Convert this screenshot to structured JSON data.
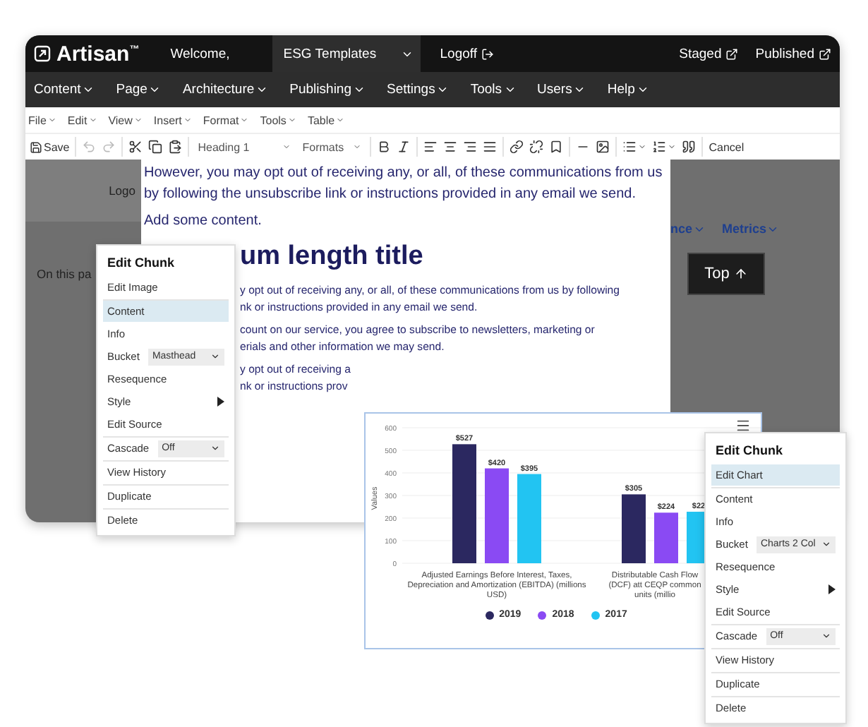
{
  "app_bar": {
    "brand": "Artisan$^{™}$",
    "welcome": "Welcome,",
    "site_select": "ESG Templates",
    "logoff": "Logoff",
    "links": [
      "Staged",
      "Published"
    ]
  },
  "nav": [
    "Content",
    "Page",
    "Architecture",
    "Publishing",
    "Settings",
    "Tools",
    "Users",
    "Help"
  ],
  "editor_menu": [
    "File",
    "Edit",
    "View",
    "Insert",
    "Format",
    "Tools",
    "Table"
  ],
  "toolbar": {
    "save": "Save",
    "undo_disabled": true,
    "redo_disabled": true,
    "block_format": "Heading 1",
    "formats": "Formats",
    "cancel": "Cancel"
  },
  "sidebar": {
    "logo": "Logo",
    "on_this_page": "On this pa"
  },
  "page": {
    "blocks": [
      {
        "kind": "paragraph",
        "text": "However, you may opt out of receiving any, or all, of these communications from us by following the unsubscribe link or instructions provided in any email we send."
      },
      {
        "kind": "paragraph",
        "text": "Add some content."
      },
      {
        "kind": "heading",
        "text": "um length title"
      },
      {
        "kind": "clipped",
        "lines": [
          "y opt out of receiving any, or all, of these communications from us by following",
          "nk or instructions provided in any email we send."
        ]
      },
      {
        "kind": "clipped",
        "lines": [
          "count on our service, you agree to subscribe to newsletters, marketing or",
          "erials and other information we may send."
        ]
      },
      {
        "kind": "clipped",
        "lines": [
          "y opt out of receiving a",
          "nk or instructions prov"
        ]
      }
    ]
  },
  "page_links": [
    "nce",
    "Metrics"
  ],
  "top_button": "Top",
  "chart": {
    "chart_data": {
      "type": "bar",
      "ylabel": "Values",
      "categories": [
        "Adjusted Earnings Before Interest, Taxes, Depreciation and Amortization (EBITDA) (millions USD)",
        "Distributable Cash Flow (DCF) att CEQP common units (millio"
      ],
      "ylim": [
        0,
        600
      ],
      "grid": true,
      "legend": "bottom",
      "value_labels": [
        [
          "$527",
          "$305"
        ],
        [
          "$420",
          "$224"
        ],
        [
          "$395",
          "$22"
        ]
      ],
      "yticks": [
        0,
        100,
        200,
        300,
        400,
        500,
        600
      ],
      "series": [
        {
          "name": "2019",
          "color": "#2b2860",
          "values": [
            527,
            305
          ]
        },
        {
          "name": "2018",
          "color": "#8a4af3",
          "values": [
            420,
            224
          ]
        },
        {
          "name": "2017",
          "color": "#22c4f2",
          "values": [
            395,
            228
          ]
        }
      ]
    }
  },
  "context_menus": [
    {
      "title": "Edit Chunk",
      "items": [
        {
          "kind": "action",
          "label": "Edit Image",
          "selected": false,
          "group_start": false
        },
        {
          "kind": "action",
          "label": "Content",
          "selected": true,
          "group_start": true
        },
        {
          "kind": "action",
          "label": "Info",
          "selected": false,
          "group_start": false
        },
        {
          "kind": "select",
          "label": "Bucket",
          "value": "Masthead",
          "selected": false,
          "group_start": false
        },
        {
          "kind": "action",
          "label": "Resequence",
          "selected": false,
          "group_start": false
        },
        {
          "kind": "submenu",
          "label": "Style",
          "selected": false,
          "group_start": false
        },
        {
          "kind": "action",
          "label": "Edit Source",
          "selected": false,
          "group_start": false
        },
        {
          "kind": "select",
          "label": "Cascade",
          "value": "Off",
          "selected": false,
          "group_start": true
        },
        {
          "kind": "action",
          "label": "View History",
          "selected": false,
          "group_start": true
        },
        {
          "kind": "action",
          "label": "Duplicate",
          "selected": false,
          "group_start": true
        },
        {
          "kind": "action",
          "label": "Delete",
          "selected": false,
          "group_start": true
        }
      ]
    },
    {
      "title": "Edit Chunk",
      "items": [
        {
          "kind": "action",
          "label": "Edit Chart",
          "selected": true,
          "group_start": false
        },
        {
          "kind": "action",
          "label": "Content",
          "selected": false,
          "group_start": true
        },
        {
          "kind": "action",
          "label": "Info",
          "selected": false,
          "group_start": false
        },
        {
          "kind": "select",
          "label": "Bucket",
          "value": "Charts 2 Col",
          "selected": false,
          "group_start": false
        },
        {
          "kind": "action",
          "label": "Resequence",
          "selected": false,
          "group_start": false
        },
        {
          "kind": "submenu",
          "label": "Style",
          "selected": false,
          "group_start": false
        },
        {
          "kind": "action",
          "label": "Edit Source",
          "selected": false,
          "group_start": false
        },
        {
          "kind": "select",
          "label": "Cascade",
          "value": "Off",
          "selected": false,
          "group_start": true
        },
        {
          "kind": "action",
          "label": "View History",
          "selected": false,
          "group_start": true
        },
        {
          "kind": "action",
          "label": "Duplicate",
          "selected": false,
          "group_start": true
        },
        {
          "kind": "action",
          "label": "Delete",
          "selected": false,
          "group_start": true
        }
      ]
    }
  ]
}
